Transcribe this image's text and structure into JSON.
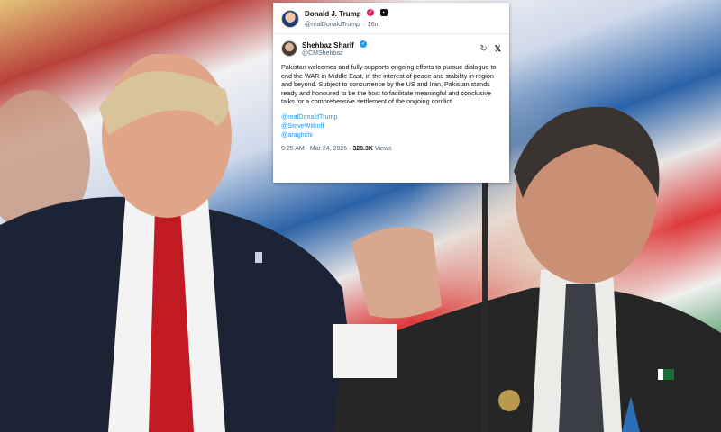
{
  "outer_post": {
    "author_name": "Donald J. Trump",
    "handle": "@realDonaldTrump",
    "time": "16m"
  },
  "quoted_post": {
    "author_name": "Shehbaz Sharif",
    "handle": "@CMShehbaz",
    "text": "Pakistan welcomes and fully supports ongoing efforts to pursue dialogue to end the WAR in Middle East, in the interest of peace and stability in region and beyond. Subject to concurrence by the US and Iran, Pakistan stands ready and honoured to be the host to facilitate meaningful and conclusive talks for a comprehensive settlement of the ongoing conflict.",
    "mentions": [
      "@realDonaldTrump",
      "@SteveWitkoff",
      "@araghchi"
    ],
    "timestamp": "9:25 AM · Mar 24, 2026 · ",
    "views_count": "328.3K",
    "views_label": " Views"
  },
  "icons": {
    "verified": "verified-badge-icon",
    "affiliate": "affiliate-square-icon",
    "refresh": "refresh-icon",
    "x_logo": "x-logo-icon"
  },
  "colors": {
    "link": "#1d9bf0",
    "text": "#0f1419",
    "muted": "#536471"
  }
}
